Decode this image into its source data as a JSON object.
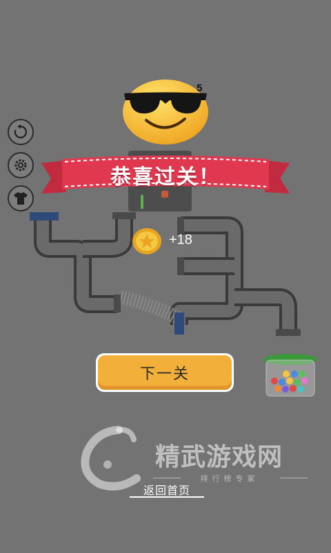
{
  "level": {
    "number": "5"
  },
  "banner": {
    "title": "恭喜过关！"
  },
  "reward": {
    "amount": "+18"
  },
  "buttons": {
    "next_level": "下一关",
    "home": "返回首页"
  },
  "watermark": {
    "name": "精武游戏网",
    "tagline": "排行榜专家"
  },
  "side_icons": [
    "restart-icon",
    "settings-icon",
    "shirt-icon"
  ],
  "colors": {
    "background": "#737373",
    "banner_red": "#e0394f",
    "button_orange": "#f2b03a",
    "pipe_gray": "#5a5a5a",
    "pipe_blue": "#2f4a7a"
  }
}
